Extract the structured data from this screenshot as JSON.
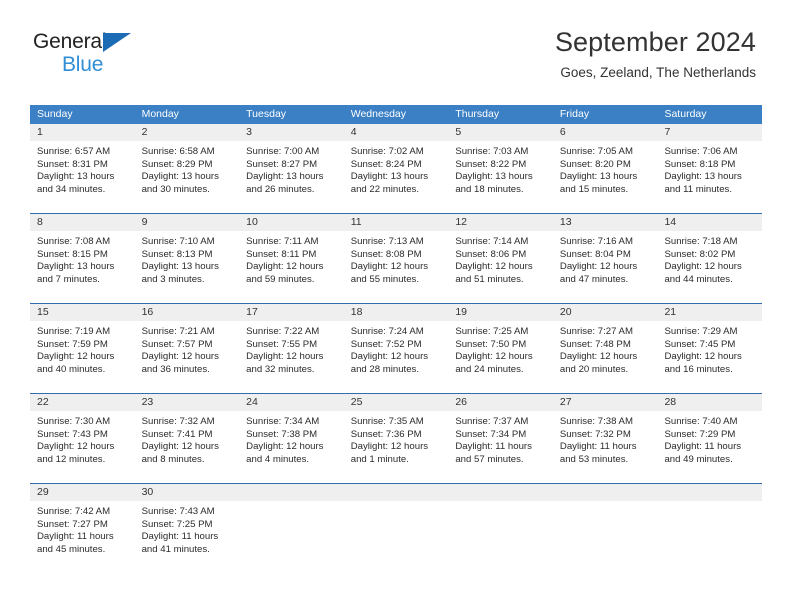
{
  "brand": {
    "name_part1": "General",
    "name_part2": "Blue",
    "triangle_color": "#1b6cb5",
    "part2_color": "#2f8ed6"
  },
  "header": {
    "title": "September 2024",
    "subtitle": "Goes, Zeeland, The Netherlands"
  },
  "theme": {
    "header_row_bg": "#3b7fc4",
    "week_divider": "#2f6fb0",
    "day_band_bg": "#efefef",
    "text_color": "#2b2b2b"
  },
  "weekdays": [
    "Sunday",
    "Monday",
    "Tuesday",
    "Wednesday",
    "Thursday",
    "Friday",
    "Saturday"
  ],
  "weeks": [
    [
      {
        "day": "1",
        "sunrise": "Sunrise: 6:57 AM",
        "sunset": "Sunset: 8:31 PM",
        "daylight1": "Daylight: 13 hours",
        "daylight2": "and 34 minutes."
      },
      {
        "day": "2",
        "sunrise": "Sunrise: 6:58 AM",
        "sunset": "Sunset: 8:29 PM",
        "daylight1": "Daylight: 13 hours",
        "daylight2": "and 30 minutes."
      },
      {
        "day": "3",
        "sunrise": "Sunrise: 7:00 AM",
        "sunset": "Sunset: 8:27 PM",
        "daylight1": "Daylight: 13 hours",
        "daylight2": "and 26 minutes."
      },
      {
        "day": "4",
        "sunrise": "Sunrise: 7:02 AM",
        "sunset": "Sunset: 8:24 PM",
        "daylight1": "Daylight: 13 hours",
        "daylight2": "and 22 minutes."
      },
      {
        "day": "5",
        "sunrise": "Sunrise: 7:03 AM",
        "sunset": "Sunset: 8:22 PM",
        "daylight1": "Daylight: 13 hours",
        "daylight2": "and 18 minutes."
      },
      {
        "day": "6",
        "sunrise": "Sunrise: 7:05 AM",
        "sunset": "Sunset: 8:20 PM",
        "daylight1": "Daylight: 13 hours",
        "daylight2": "and 15 minutes."
      },
      {
        "day": "7",
        "sunrise": "Sunrise: 7:06 AM",
        "sunset": "Sunset: 8:18 PM",
        "daylight1": "Daylight: 13 hours",
        "daylight2": "and 11 minutes."
      }
    ],
    [
      {
        "day": "8",
        "sunrise": "Sunrise: 7:08 AM",
        "sunset": "Sunset: 8:15 PM",
        "daylight1": "Daylight: 13 hours",
        "daylight2": "and 7 minutes."
      },
      {
        "day": "9",
        "sunrise": "Sunrise: 7:10 AM",
        "sunset": "Sunset: 8:13 PM",
        "daylight1": "Daylight: 13 hours",
        "daylight2": "and 3 minutes."
      },
      {
        "day": "10",
        "sunrise": "Sunrise: 7:11 AM",
        "sunset": "Sunset: 8:11 PM",
        "daylight1": "Daylight: 12 hours",
        "daylight2": "and 59 minutes."
      },
      {
        "day": "11",
        "sunrise": "Sunrise: 7:13 AM",
        "sunset": "Sunset: 8:08 PM",
        "daylight1": "Daylight: 12 hours",
        "daylight2": "and 55 minutes."
      },
      {
        "day": "12",
        "sunrise": "Sunrise: 7:14 AM",
        "sunset": "Sunset: 8:06 PM",
        "daylight1": "Daylight: 12 hours",
        "daylight2": "and 51 minutes."
      },
      {
        "day": "13",
        "sunrise": "Sunrise: 7:16 AM",
        "sunset": "Sunset: 8:04 PM",
        "daylight1": "Daylight: 12 hours",
        "daylight2": "and 47 minutes."
      },
      {
        "day": "14",
        "sunrise": "Sunrise: 7:18 AM",
        "sunset": "Sunset: 8:02 PM",
        "daylight1": "Daylight: 12 hours",
        "daylight2": "and 44 minutes."
      }
    ],
    [
      {
        "day": "15",
        "sunrise": "Sunrise: 7:19 AM",
        "sunset": "Sunset: 7:59 PM",
        "daylight1": "Daylight: 12 hours",
        "daylight2": "and 40 minutes."
      },
      {
        "day": "16",
        "sunrise": "Sunrise: 7:21 AM",
        "sunset": "Sunset: 7:57 PM",
        "daylight1": "Daylight: 12 hours",
        "daylight2": "and 36 minutes."
      },
      {
        "day": "17",
        "sunrise": "Sunrise: 7:22 AM",
        "sunset": "Sunset: 7:55 PM",
        "daylight1": "Daylight: 12 hours",
        "daylight2": "and 32 minutes."
      },
      {
        "day": "18",
        "sunrise": "Sunrise: 7:24 AM",
        "sunset": "Sunset: 7:52 PM",
        "daylight1": "Daylight: 12 hours",
        "daylight2": "and 28 minutes."
      },
      {
        "day": "19",
        "sunrise": "Sunrise: 7:25 AM",
        "sunset": "Sunset: 7:50 PM",
        "daylight1": "Daylight: 12 hours",
        "daylight2": "and 24 minutes."
      },
      {
        "day": "20",
        "sunrise": "Sunrise: 7:27 AM",
        "sunset": "Sunset: 7:48 PM",
        "daylight1": "Daylight: 12 hours",
        "daylight2": "and 20 minutes."
      },
      {
        "day": "21",
        "sunrise": "Sunrise: 7:29 AM",
        "sunset": "Sunset: 7:45 PM",
        "daylight1": "Daylight: 12 hours",
        "daylight2": "and 16 minutes."
      }
    ],
    [
      {
        "day": "22",
        "sunrise": "Sunrise: 7:30 AM",
        "sunset": "Sunset: 7:43 PM",
        "daylight1": "Daylight: 12 hours",
        "daylight2": "and 12 minutes."
      },
      {
        "day": "23",
        "sunrise": "Sunrise: 7:32 AM",
        "sunset": "Sunset: 7:41 PM",
        "daylight1": "Daylight: 12 hours",
        "daylight2": "and 8 minutes."
      },
      {
        "day": "24",
        "sunrise": "Sunrise: 7:34 AM",
        "sunset": "Sunset: 7:38 PM",
        "daylight1": "Daylight: 12 hours",
        "daylight2": "and 4 minutes."
      },
      {
        "day": "25",
        "sunrise": "Sunrise: 7:35 AM",
        "sunset": "Sunset: 7:36 PM",
        "daylight1": "Daylight: 12 hours",
        "daylight2": "and 1 minute."
      },
      {
        "day": "26",
        "sunrise": "Sunrise: 7:37 AM",
        "sunset": "Sunset: 7:34 PM",
        "daylight1": "Daylight: 11 hours",
        "daylight2": "and 57 minutes."
      },
      {
        "day": "27",
        "sunrise": "Sunrise: 7:38 AM",
        "sunset": "Sunset: 7:32 PM",
        "daylight1": "Daylight: 11 hours",
        "daylight2": "and 53 minutes."
      },
      {
        "day": "28",
        "sunrise": "Sunrise: 7:40 AM",
        "sunset": "Sunset: 7:29 PM",
        "daylight1": "Daylight: 11 hours",
        "daylight2": "and 49 minutes."
      }
    ],
    [
      {
        "day": "29",
        "sunrise": "Sunrise: 7:42 AM",
        "sunset": "Sunset: 7:27 PM",
        "daylight1": "Daylight: 11 hours",
        "daylight2": "and 45 minutes."
      },
      {
        "day": "30",
        "sunrise": "Sunrise: 7:43 AM",
        "sunset": "Sunset: 7:25 PM",
        "daylight1": "Daylight: 11 hours",
        "daylight2": "and 41 minutes."
      },
      {
        "day": "",
        "sunrise": "",
        "sunset": "",
        "daylight1": "",
        "daylight2": ""
      },
      {
        "day": "",
        "sunrise": "",
        "sunset": "",
        "daylight1": "",
        "daylight2": ""
      },
      {
        "day": "",
        "sunrise": "",
        "sunset": "",
        "daylight1": "",
        "daylight2": ""
      },
      {
        "day": "",
        "sunrise": "",
        "sunset": "",
        "daylight1": "",
        "daylight2": ""
      },
      {
        "day": "",
        "sunrise": "",
        "sunset": "",
        "daylight1": "",
        "daylight2": ""
      }
    ]
  ]
}
